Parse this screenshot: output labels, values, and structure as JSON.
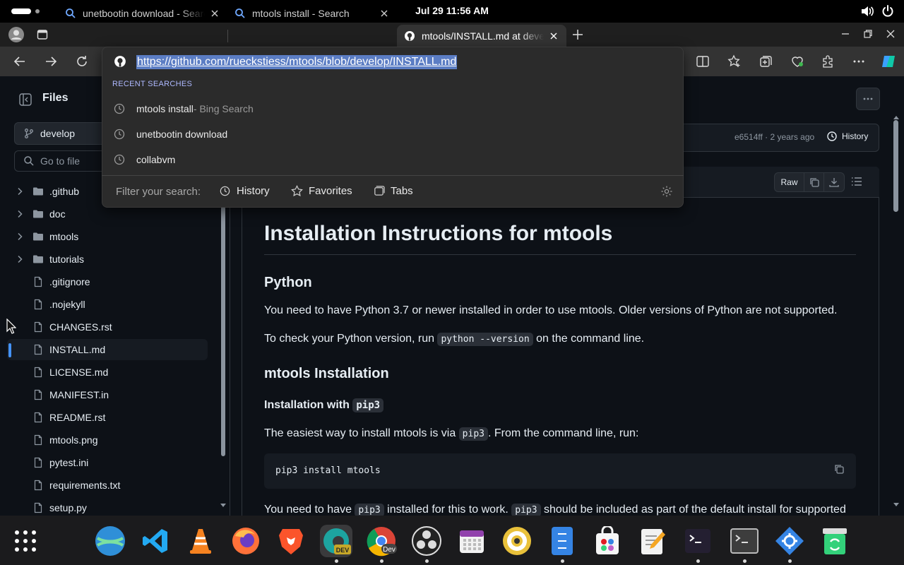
{
  "os": {
    "clock": "Jul 29  11:56 AM"
  },
  "tabs": [
    {
      "title": "unetbootin download - Search",
      "active": false
    },
    {
      "title": "mtools install - Search",
      "active": false
    },
    {
      "title": "mtools/INSTALL.md at develop",
      "active": true
    }
  ],
  "omnibox": {
    "url": "https://github.com/rueckstiess/mtools/blob/develop/INSTALL.md",
    "recent_label": "RECENT SEARCHES",
    "recent": [
      {
        "text": "mtools install",
        "sub": " - Bing Search"
      },
      {
        "text": "unetbootin download",
        "sub": ""
      },
      {
        "text": "collabvm",
        "sub": ""
      }
    ],
    "filter_label": "Filter your search:",
    "filters": [
      "History",
      "Favorites",
      "Tabs"
    ]
  },
  "files_panel": {
    "title": "Files",
    "branch": "develop",
    "goto_placeholder": "Go to file",
    "items": [
      {
        "name": ".github",
        "type": "folder"
      },
      {
        "name": "doc",
        "type": "folder"
      },
      {
        "name": "mtools",
        "type": "folder"
      },
      {
        "name": "tutorials",
        "type": "folder"
      },
      {
        "name": ".gitignore",
        "type": "file"
      },
      {
        "name": ".nojekyll",
        "type": "file"
      },
      {
        "name": "CHANGES.rst",
        "type": "file"
      },
      {
        "name": "INSTALL.md",
        "type": "file",
        "selected": true
      },
      {
        "name": "LICENSE.md",
        "type": "file"
      },
      {
        "name": "MANIFEST.in",
        "type": "file"
      },
      {
        "name": "README.rst",
        "type": "file"
      },
      {
        "name": "mtools.png",
        "type": "file"
      },
      {
        "name": "pytest.ini",
        "type": "file"
      },
      {
        "name": "requirements.txt",
        "type": "file"
      },
      {
        "name": "setup.py",
        "type": "file"
      }
    ]
  },
  "commit": {
    "meta": "e6514ff · 2 years ago",
    "history_label": "History"
  },
  "file_header": {
    "raw_label": "Raw"
  },
  "doc": {
    "h1": "Installation Instructions for mtools",
    "h2_python": "Python",
    "p1": "You need to have Python 3.7 or newer installed in order to use mtools. Older versions of Python are not supported.",
    "p2_before": "To check your Python version, run ",
    "p2_code": "python --version",
    "p2_after": " on the command line.",
    "h2_install": "mtools Installation",
    "h4_pip_prefix": "Installation with ",
    "h4_pip_code": "pip3",
    "p3_before": "The easiest way to install mtools is via ",
    "p3_code": "pip3",
    "p3_after": ". From the command line, run:",
    "code_block": "pip3 install mtools",
    "p4_a": "You need to have ",
    "p4_code1": "pip3",
    "p4_b": " installed for this to work. ",
    "p4_code2": "pip3",
    "p4_c": " should be included as part of the default install for supported"
  },
  "taskbar": {
    "apps": [
      "app-grid-icon",
      "globe-icon",
      "vscode-icon",
      "vlc-icon",
      "firefox-icon",
      "brave-icon",
      "edge-dev-icon",
      "chrome-dev-icon",
      "obs-icon",
      "calendar-icon",
      "audio-icon",
      "file-manager-icon",
      "store-icon",
      "text-editor-icon",
      "terminal-icon",
      "terminal-alt-icon",
      "settings-icon",
      "trash-icon"
    ]
  },
  "colors": {
    "accent": "#4493f8",
    "page_bg": "#0d1117",
    "selection": "#5b7dc4"
  }
}
